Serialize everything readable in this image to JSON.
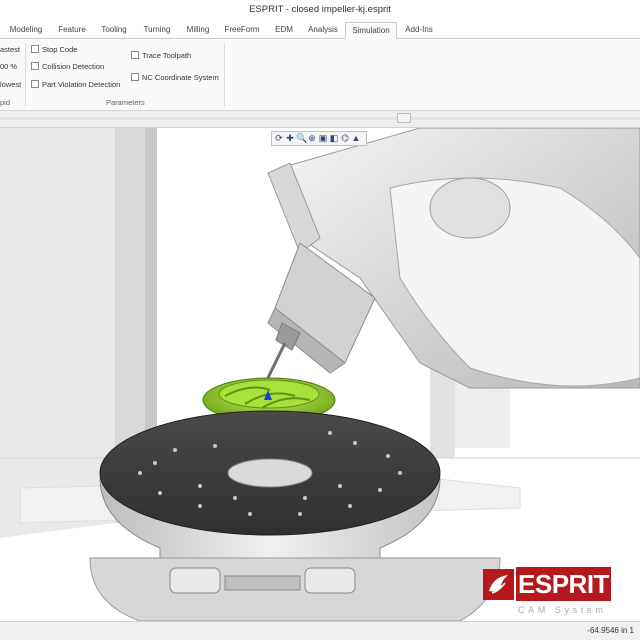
{
  "window": {
    "title": "ESPRIT - closed impeller-kj.esprit"
  },
  "ribbon_tabs": [
    {
      "label": "Modeling"
    },
    {
      "label": "Feature"
    },
    {
      "label": "Tooling"
    },
    {
      "label": "Turning"
    },
    {
      "label": "Milling"
    },
    {
      "label": "FreeForm"
    },
    {
      "label": "EDM"
    },
    {
      "label": "Analysis"
    },
    {
      "label": "Simulation",
      "active": true
    },
    {
      "label": "Add-Ins"
    }
  ],
  "ribbon": {
    "speed_group": {
      "fastest_label": "astest",
      "percent_label": "00 %",
      "slowest_label": "lowest",
      "group_label": "pid"
    },
    "options": [
      {
        "label": "Stop Code",
        "checked": false
      },
      {
        "label": "Collision Detection",
        "checked": false
      },
      {
        "label": "Part Violation Detection",
        "checked": false
      }
    ],
    "parameters": [
      {
        "label": "Trace Toolpath",
        "checked": false
      },
      {
        "label": "NC Coordinate System",
        "checked": false
      }
    ],
    "parameters_group_label": "Parameters"
  },
  "viewport_toolbar": {
    "icons": [
      "rotate-icon",
      "pan-icon",
      "zoom-icon",
      "zoom-window-icon",
      "view-cube-icon",
      "shade-icon",
      "wireframe-icon",
      "render-icon"
    ],
    "glyphs": [
      "⟳",
      "✚",
      "🔍",
      "⊕",
      "▣",
      "◧",
      "⌬",
      "▲"
    ]
  },
  "status_bar": {
    "coordinates": "-64.9546 in  1"
  },
  "logo": {
    "word": "ESPRIT",
    "subtitle": "CAM System"
  },
  "colors": {
    "logo_red": "#b5191e",
    "impeller_green": "#9bd42a",
    "table_dark": "#3c3c3c",
    "machine_gray": "#dcdcdc"
  }
}
